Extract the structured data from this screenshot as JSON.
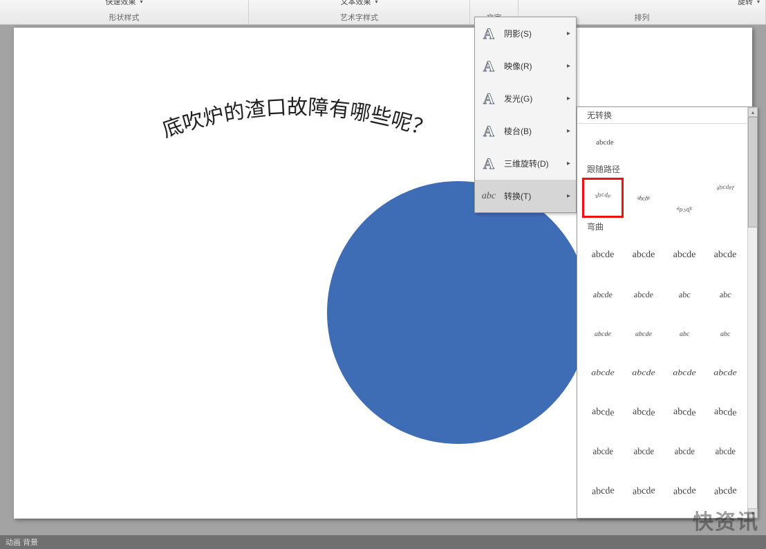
{
  "ribbon": {
    "shape_style": {
      "label": "形状样式",
      "btn": "快速效果"
    },
    "wordart_style": {
      "label": "艺术字样式",
      "btn": "文本效果"
    },
    "text": {
      "label": "文字"
    },
    "arrange": {
      "label": "排列",
      "btn": "旋转"
    }
  },
  "canvas": {
    "arched_text": "底吹炉的渣口故障有哪些呢？",
    "shape": {
      "type": "circle",
      "fill": "#3e6cb5"
    }
  },
  "effect_menu": [
    {
      "key": "shadow",
      "label": "阴影(S)",
      "icon": "A"
    },
    {
      "key": "reflect",
      "label": "映像(R)",
      "icon": "A"
    },
    {
      "key": "glow",
      "label": "发光(G)",
      "icon": "A"
    },
    {
      "key": "bevel",
      "label": "棱台(B)",
      "icon": "A"
    },
    {
      "key": "3drotate",
      "label": "三维旋转(D)",
      "icon": "A"
    },
    {
      "key": "transform",
      "label": "转换(T)",
      "icon": "abc",
      "active": true
    }
  ],
  "transform_panel": {
    "section_none": "无转换",
    "none_preview": "abcde",
    "section_follow": "跟随路径",
    "follow_items": [
      {
        "style": "arch-up",
        "text": "abcde",
        "selected": true
      },
      {
        "style": "arch-down",
        "text": "abcde"
      },
      {
        "style": "circle",
        "text": "abcde"
      },
      {
        "style": "button",
        "text": "abcdef"
      }
    ],
    "section_warp": "弯曲",
    "warp_items": [
      {
        "text": "abcde"
      },
      {
        "text": "abcde"
      },
      {
        "text": "abcde"
      },
      {
        "text": "abcde"
      },
      {
        "text": "abcde"
      },
      {
        "text": "abcde"
      },
      {
        "text": "abc"
      },
      {
        "text": "abc"
      },
      {
        "text": "abcde"
      },
      {
        "text": "abcde"
      },
      {
        "text": "abc"
      },
      {
        "text": "abc"
      },
      {
        "text": "abcde"
      },
      {
        "text": "abcde"
      },
      {
        "text": "abcde"
      },
      {
        "text": "abcde"
      },
      {
        "text": "abcde"
      },
      {
        "text": "abcde"
      },
      {
        "text": "abcde"
      },
      {
        "text": "abcde"
      },
      {
        "text": "abcde"
      },
      {
        "text": "abcde"
      },
      {
        "text": "abcde"
      },
      {
        "text": "abcde"
      },
      {
        "text": "abcde"
      },
      {
        "text": "abcde"
      },
      {
        "text": "abcde"
      },
      {
        "text": "abcde"
      }
    ]
  },
  "status_bar": "动画 背景",
  "watermark": "快资讯"
}
